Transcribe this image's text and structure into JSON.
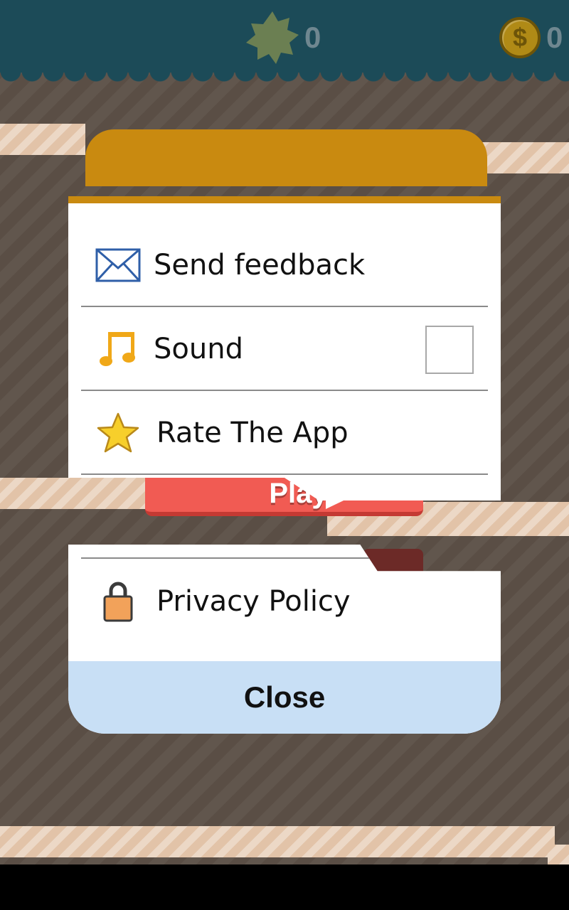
{
  "header": {
    "stars_count": "0",
    "coins_count": "0",
    "coin_symbol": "$"
  },
  "background": {
    "play_label": "Play"
  },
  "menu": {
    "items": [
      {
        "label": "Send feedback",
        "icon": "envelope-icon"
      },
      {
        "label": "Sound",
        "icon": "music-note-icon",
        "checked": false
      },
      {
        "label": "Rate The App",
        "icon": "star-icon"
      },
      {
        "label": "Privacy Policy",
        "icon": "padlock-icon"
      }
    ],
    "close_label": "Close"
  },
  "colors": {
    "topbar": "#1c4b58",
    "dialog_accent": "#c98a10",
    "close_button": "#c8dff5",
    "play_button": "#f15b53",
    "stripe": "#e2c3a8"
  }
}
